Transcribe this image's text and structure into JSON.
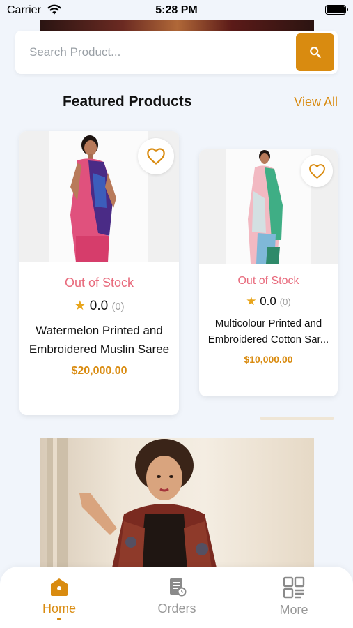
{
  "status_bar": {
    "carrier": "Carrier",
    "time": "5:28 PM"
  },
  "search": {
    "placeholder": "Search Product..."
  },
  "section": {
    "title": "Featured Products",
    "view_all": "View All"
  },
  "products": [
    {
      "stock": "Out of Stock",
      "rating": "0.0",
      "rating_count": "(0)",
      "name_line1": "Watermelon Printed and",
      "name_line2": "Embroidered Muslin Saree",
      "price": "$20,000.00"
    },
    {
      "stock": "Out of Stock",
      "rating": "0.0",
      "rating_count": "(0)",
      "name_line1": "Multicolour Printed and",
      "name_line2": "Embroidered Cotton Sar...",
      "price": "$10,000.00"
    }
  ],
  "nav": {
    "home": "Home",
    "orders": "Orders",
    "more": "More"
  },
  "colors": {
    "accent": "#d98b10",
    "out_of_stock": "#e86a7c",
    "star": "#e8a51c"
  },
  "icons": {
    "search": "search-icon",
    "favorite": "heart-outline-icon",
    "star": "star-icon",
    "home": "home-icon",
    "orders": "orders-document-icon",
    "more": "grid-more-icon"
  }
}
